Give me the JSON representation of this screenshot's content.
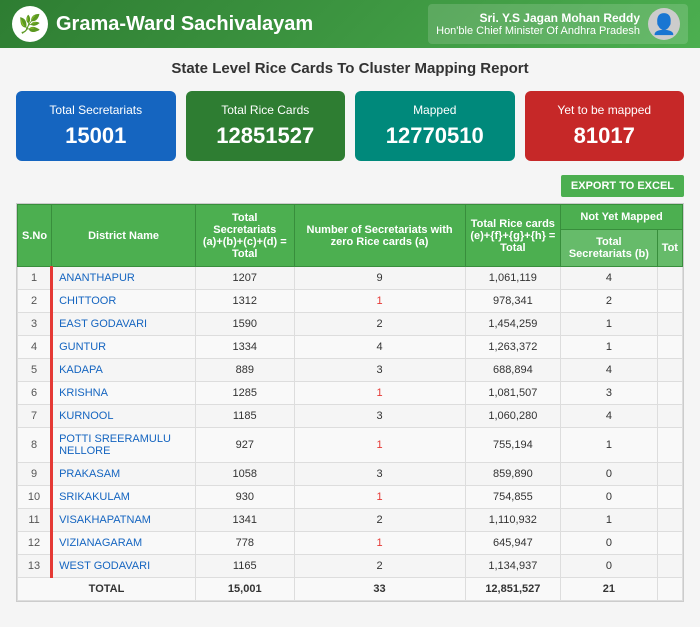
{
  "header": {
    "logo": "🌿",
    "title": "Grama-Ward Sachivalayam",
    "minister_name": "Sri. Y.S Jagan Mohan Reddy",
    "minister_role": "Hon'ble Chief Minister Of Andhra Pradesh",
    "avatar": "👤"
  },
  "page_title": "State Level Rice Cards To Cluster Mapping Report",
  "stats": [
    {
      "label": "Total Secretariats",
      "value": "15001",
      "color_class": "card-blue"
    },
    {
      "label": "Total Rice Cards",
      "value": "12851527",
      "color_class": "card-green"
    },
    {
      "label": "Mapped",
      "value": "12770510",
      "color_class": "card-teal"
    },
    {
      "label": "Yet to be mapped",
      "value": "81017",
      "color_class": "card-red"
    }
  ],
  "export_button": "EXPORT TO EXCEL",
  "table": {
    "headers": {
      "sno": "S.No",
      "district": "District Name",
      "total_sec": "Total Secretariats (a)+(b)+(c)+(d) = Total",
      "zero_rice": "Number of Secretariats with zero Rice cards (a)",
      "total_rice": "Total Rice cards (e)+{f}+{g}+{h} = Total",
      "not_yet_mapped_total_sec": "Total Secretariats (b)",
      "not_yet_mapped_total": "Tot",
      "not_yet_mapped_label": "Not Yet Mapped"
    },
    "rows": [
      {
        "sno": 1,
        "district": "ANANTHAPUR",
        "total_sec": 1207,
        "zero_rice": 9,
        "total_rice": 1061119,
        "not_mapped_sec": 4,
        "not_mapped_tot": ""
      },
      {
        "sno": 2,
        "district": "CHITTOOR",
        "total_sec": 1312,
        "zero_rice": 1,
        "total_rice": 978341,
        "not_mapped_sec": 2,
        "not_mapped_tot": ""
      },
      {
        "sno": 3,
        "district": "EAST GODAVARI",
        "total_sec": 1590,
        "zero_rice": 2,
        "total_rice": 1454259,
        "not_mapped_sec": 1,
        "not_mapped_tot": ""
      },
      {
        "sno": 4,
        "district": "GUNTUR",
        "total_sec": 1334,
        "zero_rice": 4,
        "total_rice": 1263372,
        "not_mapped_sec": 1,
        "not_mapped_tot": ""
      },
      {
        "sno": 5,
        "district": "KADAPA",
        "total_sec": 889,
        "zero_rice": 3,
        "total_rice": 688894,
        "not_mapped_sec": 4,
        "not_mapped_tot": ""
      },
      {
        "sno": 6,
        "district": "KRISHNA",
        "total_sec": 1285,
        "zero_rice": 1,
        "total_rice": 1081507,
        "not_mapped_sec": 3,
        "not_mapped_tot": ""
      },
      {
        "sno": 7,
        "district": "KURNOOL",
        "total_sec": 1185,
        "zero_rice": 3,
        "total_rice": 1060280,
        "not_mapped_sec": 4,
        "not_mapped_tot": ""
      },
      {
        "sno": 8,
        "district": "POTTI SREERAMULU NELLORE",
        "total_sec": 927,
        "zero_rice": 1,
        "total_rice": 755194,
        "not_mapped_sec": 1,
        "not_mapped_tot": ""
      },
      {
        "sno": 9,
        "district": "PRAKASAM",
        "total_sec": 1058,
        "zero_rice": 3,
        "total_rice": 859890,
        "not_mapped_sec": 0,
        "not_mapped_tot": ""
      },
      {
        "sno": 10,
        "district": "SRIKAKULAM",
        "total_sec": 930,
        "zero_rice": 1,
        "total_rice": 754855,
        "not_mapped_sec": 0,
        "not_mapped_tot": ""
      },
      {
        "sno": 11,
        "district": "VISAKHAPATNAM",
        "total_sec": 1341,
        "zero_rice": 2,
        "total_rice": 1110932,
        "not_mapped_sec": 1,
        "not_mapped_tot": ""
      },
      {
        "sno": 12,
        "district": "VIZIANAGARAM",
        "total_sec": 778,
        "zero_rice": 1,
        "total_rice": 645947,
        "not_mapped_sec": 0,
        "not_mapped_tot": ""
      },
      {
        "sno": 13,
        "district": "WEST GODAVARI",
        "total_sec": 1165,
        "zero_rice": 2,
        "total_rice": 1134937,
        "not_mapped_sec": 0,
        "not_mapped_tot": ""
      }
    ],
    "total_row": {
      "label": "TOTAL",
      "total_sec": 15001,
      "zero_rice": 33,
      "total_rice": 12851527,
      "not_mapped_sec": 21
    }
  }
}
